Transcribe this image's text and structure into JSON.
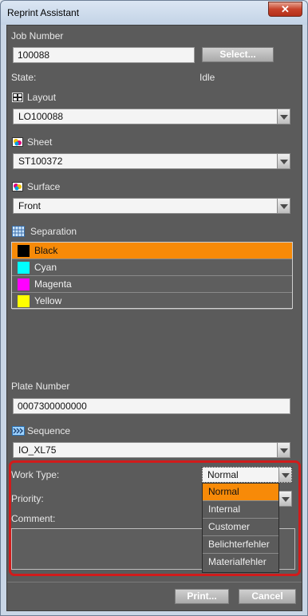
{
  "window": {
    "title": "Reprint Assistant",
    "close_glyph": "✕"
  },
  "job": {
    "label": "Job Number",
    "value": "100088",
    "select_button": "Select..."
  },
  "state": {
    "label": "State:",
    "value": "Idle"
  },
  "layout": {
    "label": "Layout",
    "value": "LO100088"
  },
  "sheet": {
    "label": "Sheet",
    "value": "ST100372"
  },
  "surface": {
    "label": "Surface",
    "value": "Front"
  },
  "separation": {
    "label": "Separation",
    "items": [
      {
        "name": "Black",
        "color": "#000000",
        "selected": true
      },
      {
        "name": "Cyan",
        "color": "#00ffff",
        "selected": false
      },
      {
        "name": "Magenta",
        "color": "#ff00ff",
        "selected": false
      },
      {
        "name": "Yellow",
        "color": "#ffff00",
        "selected": false
      }
    ]
  },
  "plate": {
    "label": "Plate Number",
    "value": "0007300000000"
  },
  "sequence": {
    "label": "Sequence",
    "value": "IO_XL75"
  },
  "work_type": {
    "label": "Work Type:",
    "value": "Normal",
    "options": [
      "Normal",
      "Internal",
      "Customer",
      "Belichterfehler",
      "Materialfehler"
    ]
  },
  "priority": {
    "label": "Priority:"
  },
  "comment": {
    "label": "Comment:"
  },
  "footer": {
    "print_button": "Print...",
    "cancel_button": "Cancel"
  },
  "colors": {
    "accent": "#f78a08",
    "highlight": "#d11b1b",
    "panel": "#5b5b5b"
  }
}
